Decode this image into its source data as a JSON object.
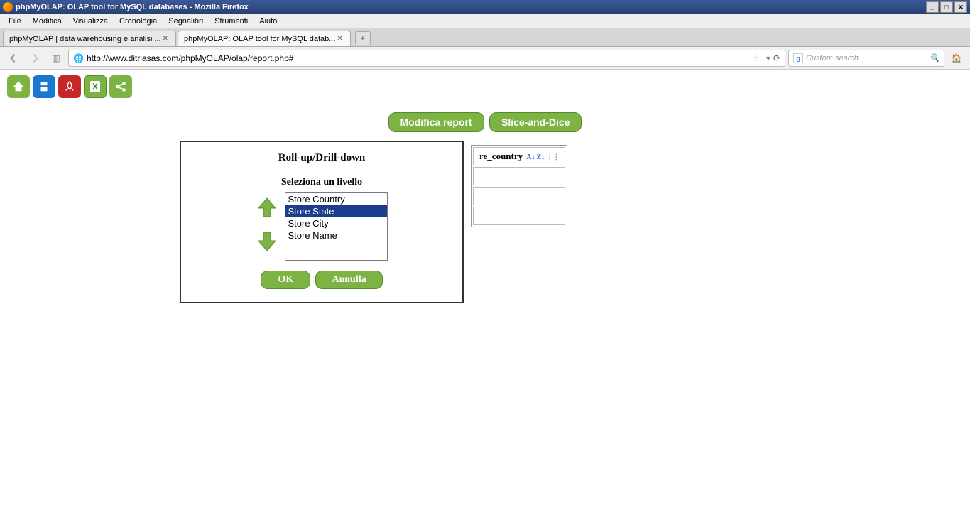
{
  "window": {
    "title": "phpMyOLAP: OLAP tool for MySQL databases - Mozilla Firefox"
  },
  "menu": [
    "File",
    "Modifica",
    "Visualizza",
    "Cronologia",
    "Segnalibri",
    "Strumenti",
    "Aiuto"
  ],
  "tabs": [
    {
      "label": "phpMyOLAP | data warehousing e analisi ...",
      "active": false
    },
    {
      "label": "phpMyOLAP: OLAP tool for MySQL datab...",
      "active": true
    }
  ],
  "url": "http://www.ditriasas.com/phpMyOLAP/olap/report.php#",
  "search_placeholder": "Custom search",
  "toolbar": {
    "home": "⌂",
    "save": "💾",
    "pdf": "PDF",
    "xls": "X",
    "share": "↗"
  },
  "buttons": {
    "report": "Modifica report",
    "slice": "Slice-and-Dice"
  },
  "dialog": {
    "title": "Roll-up/Drill-down",
    "select_label": "Seleziona un livello",
    "options": [
      "Store Country",
      "Store State",
      "Store City",
      "Store Name"
    ],
    "selected_index": 1,
    "ok": "OK",
    "cancel": "Annulla"
  },
  "back_header": "re_country"
}
